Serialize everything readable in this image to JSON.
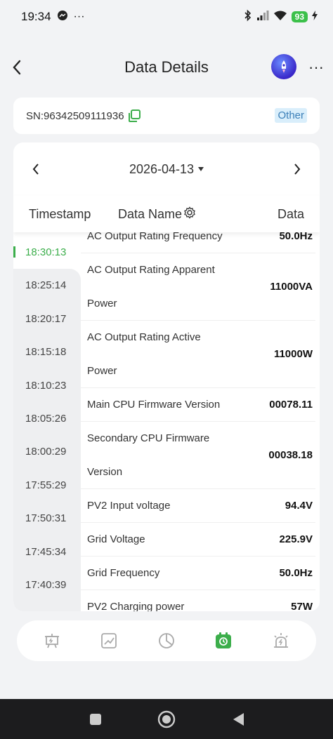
{
  "status_bar": {
    "time": "19:34",
    "battery": "93"
  },
  "header": {
    "title": "Data Details"
  },
  "device": {
    "sn": "SN:96342509111936",
    "tag": "Other"
  },
  "date_picker": {
    "date": "2026-04-13"
  },
  "columns": {
    "timestamp": "Timestamp",
    "data_name": "Data Name",
    "data": "Data"
  },
  "timestamps": [
    "18:30:13",
    "18:25:14",
    "18:20:17",
    "18:15:18",
    "18:10:23",
    "18:05:26",
    "18:00:29",
    "17:55:29",
    "17:50:31",
    "17:45:34",
    "17:40:39"
  ],
  "rows": [
    {
      "name": "AC Output Rating Frequency",
      "value": "50.0Hz"
    },
    {
      "name": "AC Output Rating Apparent Power",
      "value": "11000VA"
    },
    {
      "name": "AC Output Rating Active Power",
      "value": "11000W"
    },
    {
      "name": "Main CPU Firmware Version",
      "value": "00078.11"
    },
    {
      "name": "Secondary CPU Firmware Version",
      "value": "00038.18"
    },
    {
      "name": "PV2 Input voltage",
      "value": "94.4V"
    },
    {
      "name": "Grid Voltage",
      "value": "225.9V"
    },
    {
      "name": "Grid Frequency",
      "value": "50.0Hz"
    },
    {
      "name": "PV2 Charging power",
      "value": "57W"
    }
  ],
  "bottom_nav": {
    "items": [
      "device-icon",
      "trend-chart-icon",
      "pie-chart-icon",
      "history-data-icon",
      "alarm-icon"
    ],
    "active_index": 3,
    "active_color": "#3cae4b"
  }
}
